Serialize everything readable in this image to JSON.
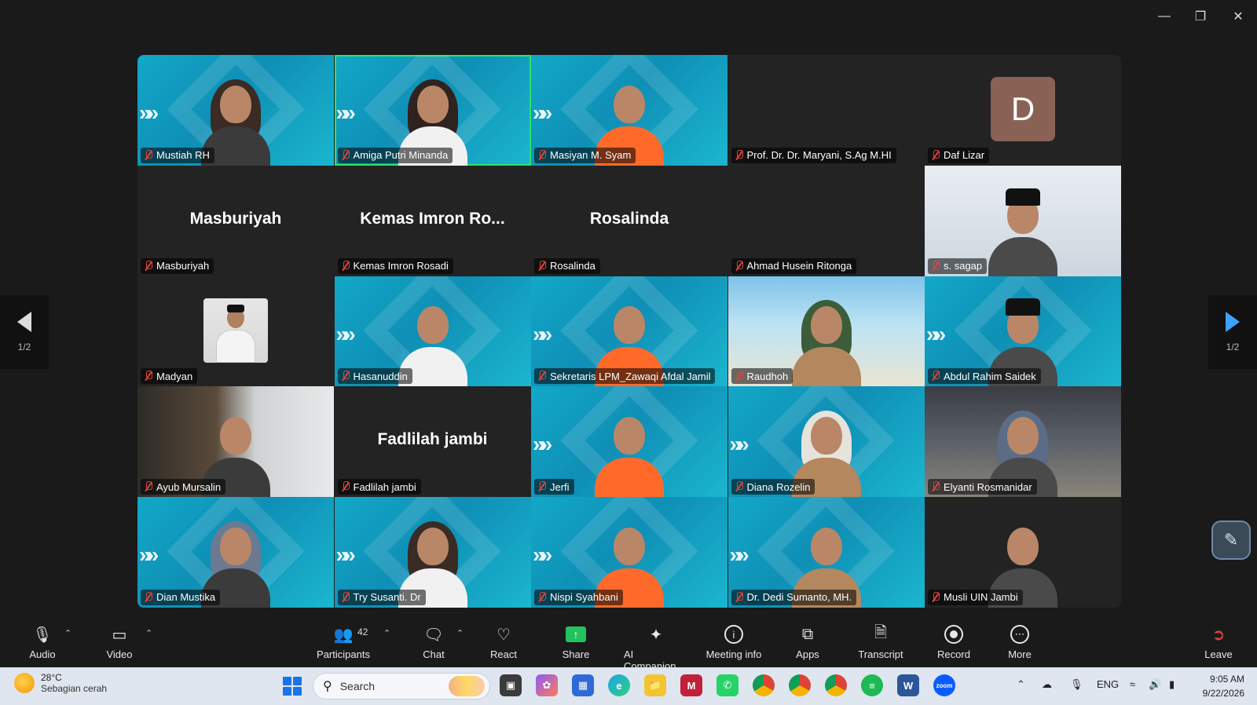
{
  "window": {
    "minimize_icon": "minimize-icon",
    "maximize_icon": "restore-icon",
    "close_icon": "close-icon"
  },
  "gallery": {
    "tiles": [
      {
        "name": "Mustiah RH",
        "style": "teal",
        "video": true
      },
      {
        "name": "Amiga Putri Minanda",
        "style": "teal",
        "video": true,
        "active_speaker": true
      },
      {
        "name": "Masiyan M. Syam",
        "style": "teal",
        "video": true
      },
      {
        "name": "Prof. Dr. Dr. Maryani, S.Ag M.HI",
        "style": "dark",
        "video": false
      },
      {
        "name": "Daf Lizar",
        "style": "dark",
        "avatar_letter": "D"
      },
      {
        "name": "Masburiyah",
        "style": "dark",
        "center_name": "Masburiyah"
      },
      {
        "name": "Kemas Imron Rosadi",
        "style": "dark",
        "center_name": "Kemas Imron Ro..."
      },
      {
        "name": "Rosalinda",
        "style": "dark",
        "center_name": "Rosalinda"
      },
      {
        "name": "Ahmad Husein Ritonga",
        "style": "dark",
        "video": false
      },
      {
        "name": "s. sagap",
        "style": "photo-white",
        "video": true
      },
      {
        "name": "Madyan",
        "style": "dark",
        "profile_photo": true
      },
      {
        "name": "Hasanuddin",
        "style": "teal",
        "video": true
      },
      {
        "name": "Sekretaris LPM_Zawaqi Afdal Jamil",
        "style": "teal",
        "video": true
      },
      {
        "name": "Raudhoh",
        "style": "photo-beach",
        "video": true
      },
      {
        "name": "Abdul Rahim Saidek",
        "style": "teal",
        "video": true
      },
      {
        "name": "Ayub Mursalin",
        "style": "photo-office",
        "video": true
      },
      {
        "name": "Fadlilah jambi",
        "style": "dark",
        "center_name": "Fadlilah jambi"
      },
      {
        "name": "Jerfi",
        "style": "teal",
        "video": true
      },
      {
        "name": "Diana Rozelin",
        "style": "teal",
        "video": true
      },
      {
        "name": "Elyanti Rosmanidar",
        "style": "photo-street",
        "video": true
      },
      {
        "name": "Dian Mustika",
        "style": "teal",
        "video": true
      },
      {
        "name": "Try Susanti. Dr",
        "style": "teal",
        "video": true
      },
      {
        "name": "Nispi Syahbani",
        "style": "teal",
        "video": true
      },
      {
        "name": "Dr. Dedi Sumanto, MH.",
        "style": "teal",
        "video": true
      },
      {
        "name": "Musli UIN Jambi",
        "style": "dark",
        "video": true
      }
    ]
  },
  "pager": {
    "left_label": "1/2",
    "right_label": "1/2"
  },
  "toolbar": {
    "audio": "Audio",
    "video": "Video",
    "participants": "Participants",
    "participants_count": "42",
    "chat": "Chat",
    "react": "React",
    "share": "Share",
    "ai_companion": "AI Companion",
    "meeting_info": "Meeting info",
    "apps": "Apps",
    "transcript": "Transcript",
    "record": "Record",
    "more": "More",
    "leave": "Leave"
  },
  "taskbar": {
    "temperature": "28°C",
    "weather_desc": "Sebagian cerah",
    "search_placeholder": "Search",
    "language": "ENG",
    "time": "9:05 AM",
    "date": "9/22/2026"
  }
}
